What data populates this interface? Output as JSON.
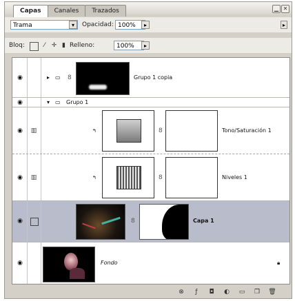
{
  "tabs": [
    {
      "label": "Capas",
      "active": true
    },
    {
      "label": "Canales",
      "active": false
    },
    {
      "label": "Trazados",
      "active": false
    }
  ],
  "window": {
    "minimize_icon": "minimize-icon",
    "close_icon": "close-icon",
    "menu_icon": "panel-menu-icon"
  },
  "blend": {
    "value": "Trama",
    "opacity_label": "Opacidad:",
    "opacity_value": "100%"
  },
  "lock": {
    "label": "Bloq:",
    "fill_label": "Relleno:",
    "fill_value": "100%"
  },
  "layers": [
    {
      "name": "Grupo 1 copia",
      "type": "group-collapsed"
    },
    {
      "name": "Grupo 1",
      "type": "group-expanded"
    },
    {
      "name": "Tono/Saturación 1",
      "type": "adjustment"
    },
    {
      "name": "Niveles 1",
      "type": "adjustment"
    },
    {
      "name": "Capa 1",
      "type": "masked-layer",
      "selected": true
    },
    {
      "name": "Fondo",
      "type": "background"
    }
  ],
  "footer_icons": [
    "link-layers-icon",
    "layer-style-icon",
    "add-mask-icon",
    "new-adjustment-icon",
    "new-group-icon",
    "new-layer-icon",
    "delete-layer-icon"
  ],
  "colors": {
    "panel": "#d4d0c8",
    "selection": "#b9bccb",
    "toolbar": "#ecebe6"
  }
}
